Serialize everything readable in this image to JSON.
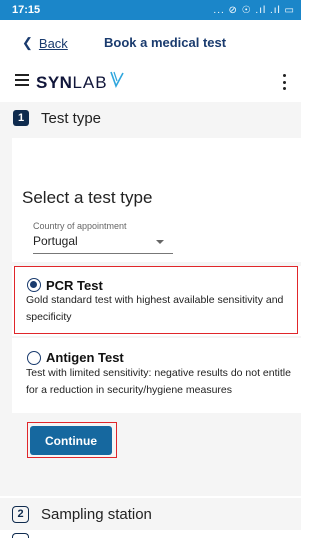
{
  "status_bar": {
    "time": "17:15",
    "icons": "... ⊘ ☉ .ıl  .ıl ▭"
  },
  "header": {
    "back_label": "Back",
    "title": "Book a medical test"
  },
  "brand": {
    "logo_bold": "SYN",
    "logo_light": "LAB"
  },
  "steps": [
    {
      "number": "1",
      "title": "Test type"
    },
    {
      "number": "2",
      "title": "Sampling station"
    }
  ],
  "select_test": {
    "title": "Select a test type",
    "country_label": "Country of appointment",
    "country_value": "Portugal"
  },
  "options": [
    {
      "title": "PCR Test",
      "description": "Gold standard test with highest available sensitivity and specificity",
      "selected": true
    },
    {
      "title": "Antigen Test",
      "description": "Test with limited sensitivity: negative results do not entitle for a reduction in security/hygiene measures",
      "selected": false
    }
  ],
  "continue_label": "Continue",
  "colors": {
    "status_bar": "#1b86c9",
    "primary_navy": "#1a3b6e",
    "button": "#16689f",
    "highlight": "#e0262a"
  }
}
